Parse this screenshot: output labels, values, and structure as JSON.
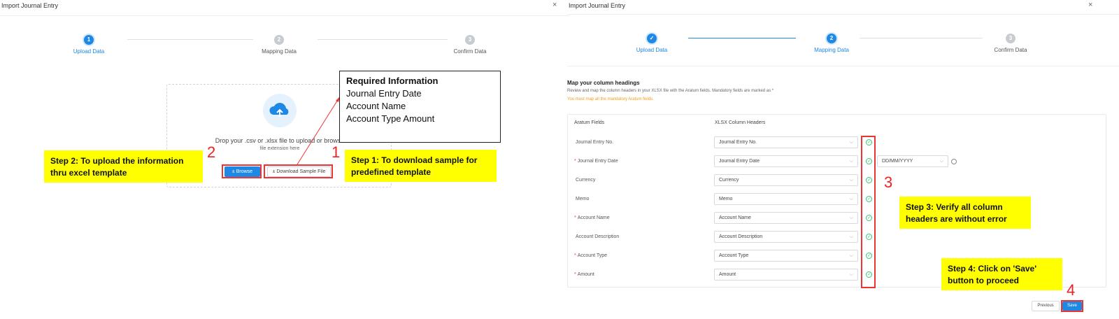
{
  "left": {
    "dialog_title": "Import Journal Entry",
    "close_glyph": "×",
    "steps": [
      {
        "num": "1",
        "label": "Upload Data"
      },
      {
        "num": "2",
        "label": "Mapping Data"
      },
      {
        "num": "3",
        "label": "Confirm Data"
      }
    ],
    "upload": {
      "drop_text": "Drop your .csv or .xlsx file to upload or browse",
      "drop_sub": "file extension here",
      "browse_label": "Browse",
      "sample_label": "Download Sample File",
      "upload_glyph": "⤒"
    },
    "info_box": {
      "title": "Required Information",
      "lines": [
        "Journal Entry Date",
        "Account Name",
        "Account Type Amount"
      ]
    },
    "notes": {
      "step1": "Step 1: To download sample for predefined template",
      "step2": "Step 2: To upload the information thru excel template"
    },
    "numbers": {
      "n1": "1",
      "n2": "2"
    }
  },
  "right": {
    "dialog_title": "Import Journal Entry",
    "close_glyph": "×",
    "steps": [
      {
        "num": "✓",
        "label": "Upload Data"
      },
      {
        "num": "2",
        "label": "Mapping Data"
      },
      {
        "num": "3",
        "label": "Confirm Data"
      }
    ],
    "mapping": {
      "title": "Map your column headings",
      "description": "Review and map the column headers in your XLSX file with the Aratum fields. Mandatory fields are marked as *",
      "warning": "You must map all the mandatory Aratum fields.",
      "col_fields": "Aratum Fields",
      "col_headers": "XLSX Column Headers",
      "rows": [
        {
          "field": "Journal Entry No.",
          "required": "",
          "value": "Journal Entry No."
        },
        {
          "field": "Journal Entry Date",
          "required": "*",
          "value": "Journal Entry Date"
        },
        {
          "field": "Currency",
          "required": "",
          "value": "Currency"
        },
        {
          "field": "Memo",
          "required": "",
          "value": "Memo"
        },
        {
          "field": "Account Name",
          "required": "*",
          "value": "Account Name"
        },
        {
          "field": "Account Description",
          "required": "",
          "value": "Account Description"
        },
        {
          "field": "Account Type",
          "required": "*",
          "value": "Account Type"
        },
        {
          "field": "Amount",
          "required": "*",
          "value": "Amount"
        }
      ],
      "date_format": "DD/MM/YYYY"
    },
    "buttons": {
      "previous": "Previous",
      "save": "Save"
    },
    "notes": {
      "step3": "Step 3: Verify all column headers are without error",
      "step4": "Step 4: Click on 'Save' button to proceed"
    },
    "numbers": {
      "n3": "3",
      "n4": "4"
    }
  }
}
